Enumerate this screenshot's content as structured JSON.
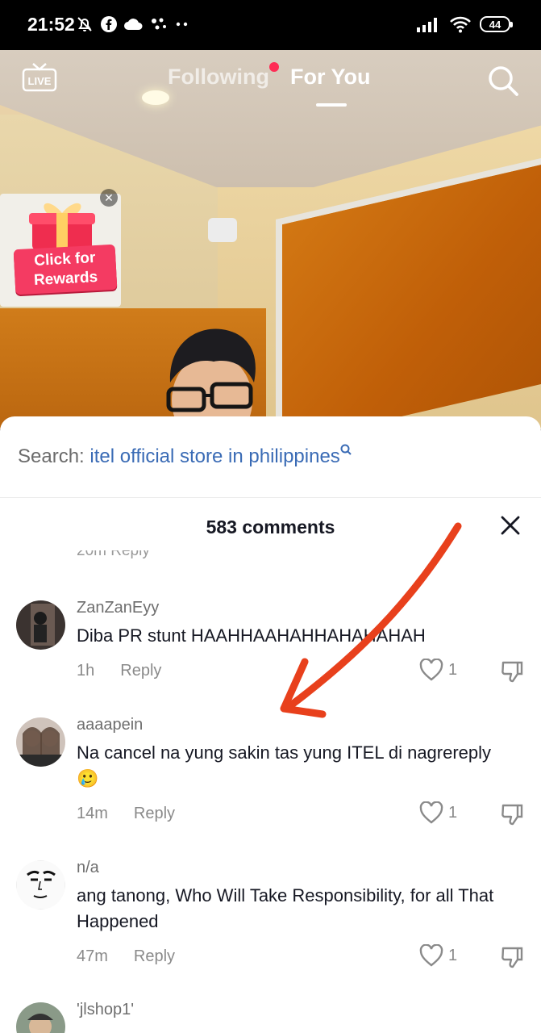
{
  "status_bar": {
    "time": "21:52",
    "battery": "44"
  },
  "nav": {
    "live_label": "LIVE",
    "following": "Following",
    "for_you": "For You"
  },
  "reward": {
    "line1": "Click for",
    "line2": "Rewards"
  },
  "search_suggestion": {
    "prefix": "Search: ",
    "term": "itel official store in philippines"
  },
  "comments_header": {
    "count_label": "583 comments"
  },
  "partial_row": "20m   Reply",
  "comments": [
    {
      "username": "ZanZanEyy",
      "text": "Diba PR stunt HAAHHAAHAHHAHAHAHAH",
      "time": "1h",
      "reply": "Reply",
      "likes": "1"
    },
    {
      "username": "aaaapein",
      "text": "Na cancel na yung sakin tas yung ITEL di nagrereply",
      "emoji": "🥲",
      "time": "14m",
      "reply": "Reply",
      "likes": "1"
    },
    {
      "username": "n/a",
      "text": "ang tanong, Who Will Take Responsibility, for all That Happened",
      "time": "47m",
      "reply": "Reply",
      "likes": "1"
    },
    {
      "username": "'jlshop1'"
    }
  ],
  "colors": {
    "accent": "#fe2c55",
    "link": "#3a6bb5",
    "annotation_arrow": "#e8401c"
  }
}
